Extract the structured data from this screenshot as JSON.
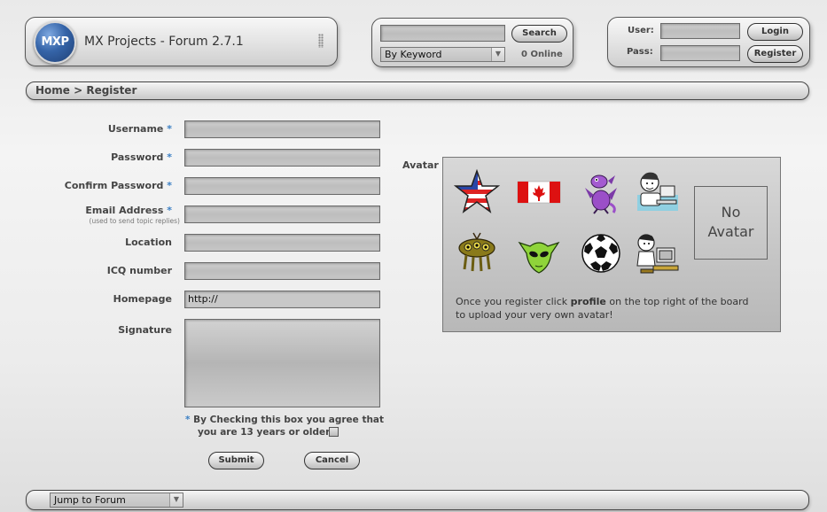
{
  "logo": {
    "badge": "MXP",
    "title": "MX Projects - Forum 2.7.1"
  },
  "search": {
    "value": "",
    "button": "Search",
    "mode": "By Keyword",
    "online": "0 Online"
  },
  "login": {
    "user_label": "User:",
    "pass_label": "Pass:",
    "login_button": "Login",
    "register_button": "Register"
  },
  "breadcrumb": "Home > Register",
  "form": {
    "required_mark": "*",
    "fields": {
      "username": "Username",
      "password": "Password",
      "confirm_password": "Confirm Password",
      "email": "Email Address",
      "email_note": "(used to send topic replies)",
      "location": "Location",
      "icq": "ICQ number",
      "homepage": "Homepage",
      "homepage_value": "http://",
      "signature": "Signature"
    },
    "agree_line1": "By Checking this box you agree that",
    "agree_line2": "you are 13 years or older.",
    "submit": "Submit",
    "cancel": "Cancel"
  },
  "avatar": {
    "label": "Avatar",
    "icons": [
      "star-flag-icon",
      "canada-flag-icon",
      "purple-dragon-icon",
      "computer-guy-icon",
      "alien-bug-icon",
      "alien-head-icon",
      "soccer-ball-icon",
      "desk-user-icon"
    ],
    "no_avatar_line1": "No",
    "no_avatar_line2": "Avatar",
    "note_pre": "Once you register click ",
    "note_bold": "profile",
    "note_post": " on the top right of the board",
    "note_line2": "to upload your very own avatar!"
  },
  "footer": {
    "jump": "Jump to Forum"
  },
  "colors": {
    "accent": "#3a7fc4",
    "logo_blue": "#2a4f86"
  }
}
